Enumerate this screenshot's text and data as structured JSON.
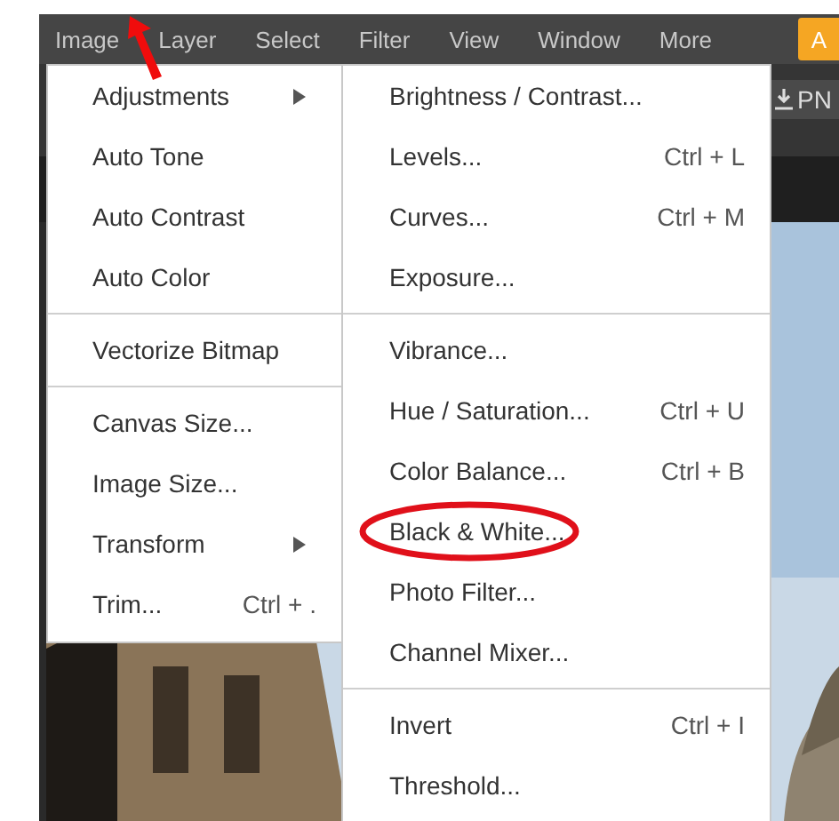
{
  "menubar": [
    {
      "label": "Image"
    },
    {
      "label": "Layer"
    },
    {
      "label": "Select"
    },
    {
      "label": "Filter"
    },
    {
      "label": "View"
    },
    {
      "label": "Window"
    },
    {
      "label": "More"
    },
    {
      "label": "A",
      "kind": "accent"
    }
  ],
  "toolbar": {
    "export_button": "PN"
  },
  "image_menu": {
    "sections": [
      [
        {
          "label": "Adjustments",
          "has_submenu": true
        },
        {
          "label": "Auto Tone",
          "has_submenu": false
        },
        {
          "label": "Auto Contrast",
          "has_submenu": false
        },
        {
          "label": "Auto Color",
          "has_submenu": false
        }
      ],
      [
        {
          "label": "Vectorize Bitmap",
          "has_submenu": false
        }
      ],
      [
        {
          "label": "Canvas Size...",
          "has_submenu": false
        },
        {
          "label": "Image Size...",
          "has_submenu": false
        },
        {
          "label": "Transform",
          "has_submenu": true
        },
        {
          "label": "Trim...",
          "shortcut": "Ctrl + .",
          "has_submenu": false
        }
      ]
    ]
  },
  "adjustments_menu": {
    "sections": [
      [
        {
          "label": "Brightness / Contrast...",
          "circled": false
        },
        {
          "label": "Levels...",
          "shortcut": "Ctrl + L",
          "circled": false
        },
        {
          "label": "Curves...",
          "shortcut": "Ctrl + M",
          "circled": false
        },
        {
          "label": "Exposure...",
          "circled": false
        }
      ],
      [
        {
          "label": "Vibrance...",
          "circled": false
        },
        {
          "label": "Hue / Saturation...",
          "shortcut": "Ctrl + U",
          "circled": false
        },
        {
          "label": "Color Balance...",
          "shortcut": "Ctrl + B",
          "circled": false
        },
        {
          "label": "Black & White...",
          "circled": true
        },
        {
          "label": "Photo Filter...",
          "circled": false
        },
        {
          "label": "Channel Mixer...",
          "circled": false
        }
      ],
      [
        {
          "label": "Invert",
          "shortcut": "Ctrl + I",
          "circled": false
        },
        {
          "label": "Threshold...",
          "circled": false
        }
      ]
    ]
  },
  "annotations": [
    {
      "kind": "arrow"
    }
  ]
}
